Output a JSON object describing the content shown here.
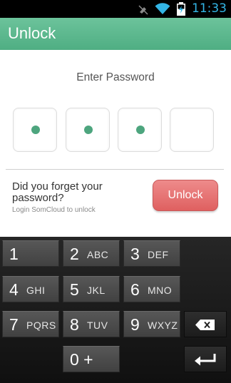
{
  "status_bar": {
    "time": "11:33",
    "icons": [
      "mute-icon",
      "wifi-icon",
      "battery-charging-icon"
    ]
  },
  "header": {
    "title": "Unlock"
  },
  "password": {
    "prompt": "Enter Password",
    "boxes": [
      true,
      true,
      true,
      false
    ]
  },
  "forgot": {
    "question": "Did you forget your password?",
    "hint": "Login SomCloud to unlock",
    "button_label": "Unlock"
  },
  "keypad": {
    "keys": [
      {
        "num": "1",
        "letters": ""
      },
      {
        "num": "2",
        "letters": "ABC"
      },
      {
        "num": "3",
        "letters": "DEF"
      },
      {
        "num": "4",
        "letters": "GHI"
      },
      {
        "num": "5",
        "letters": "JKL"
      },
      {
        "num": "6",
        "letters": "MNO"
      },
      {
        "num": "7",
        "letters": "PQRS"
      },
      {
        "num": "8",
        "letters": "TUV"
      },
      {
        "num": "9",
        "letters": "WXYZ"
      },
      {
        "num": "0 +",
        "letters": ""
      }
    ],
    "backspace_icon": "backspace-icon",
    "enter_icon": "enter-icon"
  },
  "colors": {
    "accent": "#5cb88f",
    "dot": "#4da57e",
    "unlock_button": "#e57373",
    "status_time": "#33b5e5"
  }
}
